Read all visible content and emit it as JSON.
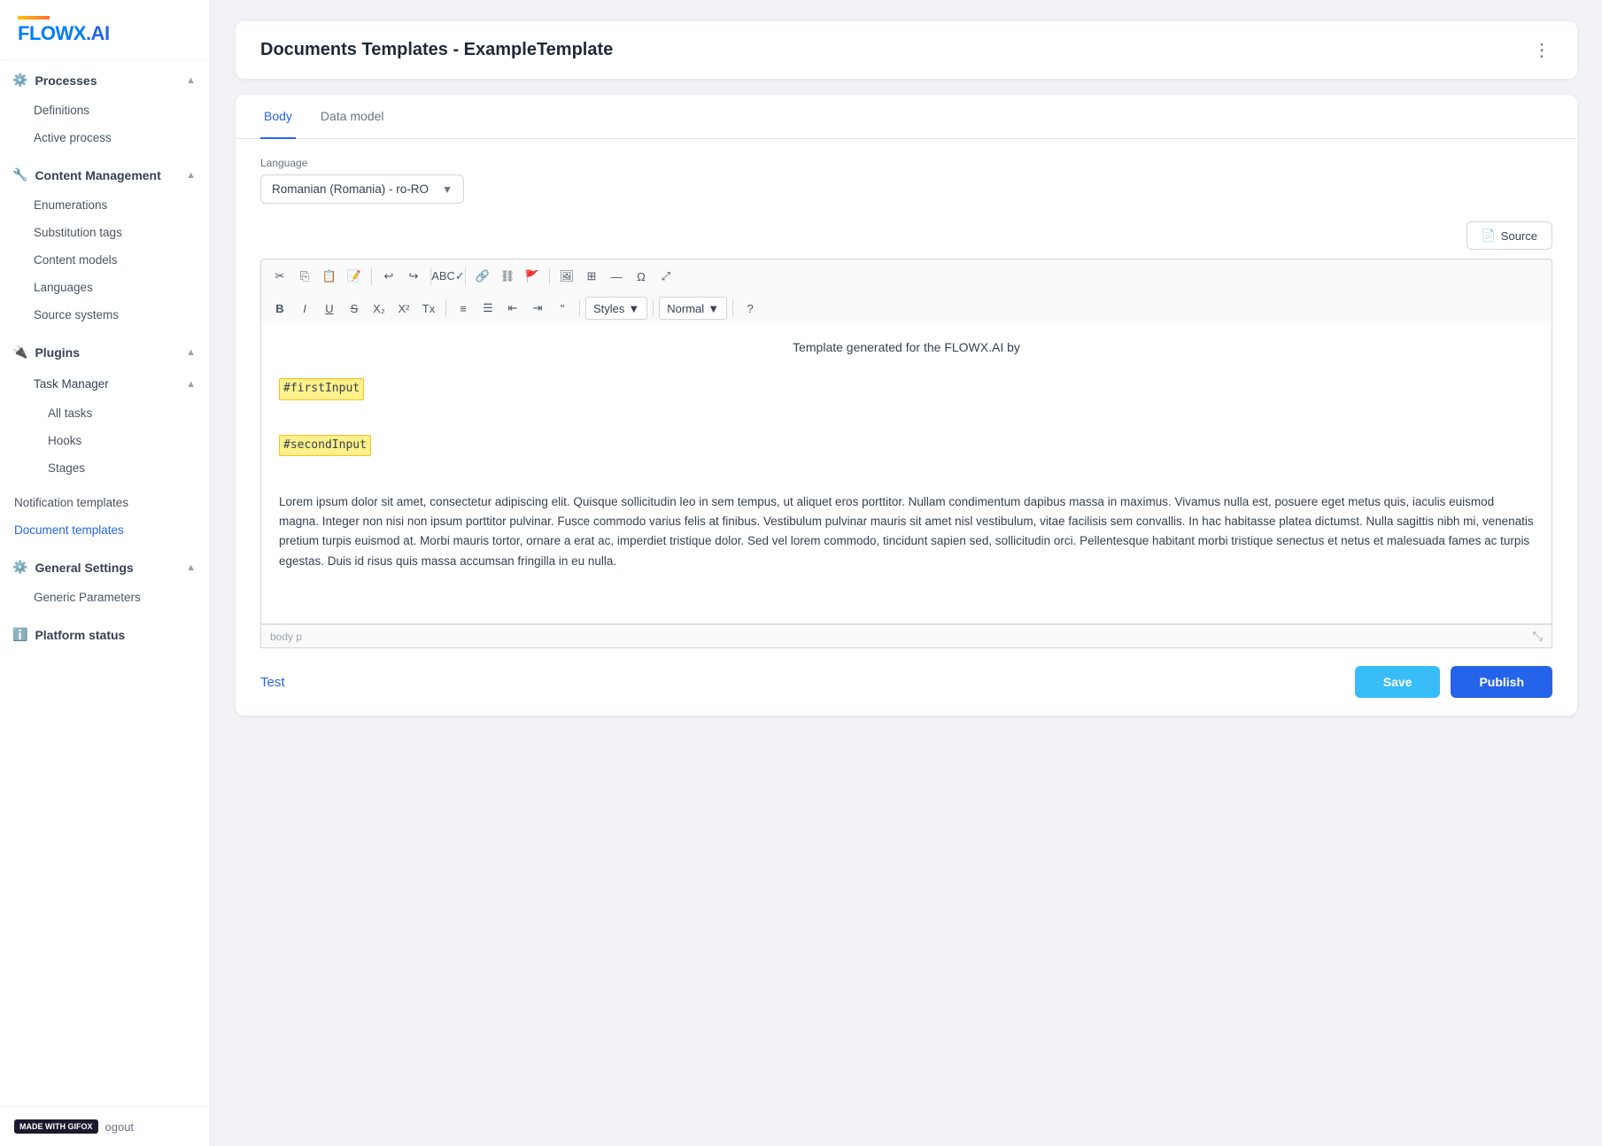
{
  "sidebar": {
    "logo": "FLOWX",
    "logo_dot": ".AI",
    "sections": [
      {
        "id": "processes",
        "label": "Processes",
        "icon": "⚙",
        "expanded": true,
        "items": [
          {
            "id": "definitions",
            "label": "Definitions",
            "active": false
          },
          {
            "id": "active-process",
            "label": "Active process",
            "active": false
          }
        ]
      },
      {
        "id": "content-management",
        "label": "Content Management",
        "icon": "🔧",
        "expanded": true,
        "items": [
          {
            "id": "enumerations",
            "label": "Enumerations",
            "active": false
          },
          {
            "id": "substitution-tags",
            "label": "Substitution tags",
            "active": false
          },
          {
            "id": "content-models",
            "label": "Content models",
            "active": false
          },
          {
            "id": "languages",
            "label": "Languages",
            "active": false
          },
          {
            "id": "source-systems",
            "label": "Source systems",
            "active": false
          }
        ]
      },
      {
        "id": "plugins",
        "label": "Plugins",
        "icon": "🔌",
        "expanded": true,
        "items": [],
        "children": [
          {
            "id": "task-manager",
            "label": "Task Manager",
            "expanded": true,
            "items": [
              {
                "id": "all-tasks",
                "label": "All tasks",
                "active": false
              },
              {
                "id": "hooks",
                "label": "Hooks",
                "active": false
              },
              {
                "id": "stages",
                "label": "Stages",
                "active": false
              }
            ]
          }
        ]
      },
      {
        "id": "notification-templates",
        "label": "Notification templates",
        "active": false
      },
      {
        "id": "document-templates",
        "label": "Document templates",
        "active": true
      },
      {
        "id": "general-settings",
        "label": "General Settings",
        "icon": "⚙",
        "expanded": true,
        "items": [
          {
            "id": "generic-parameters",
            "label": "Generic Parameters",
            "active": false
          }
        ]
      },
      {
        "id": "platform-status",
        "label": "Platform status",
        "icon": "ℹ",
        "expanded": false
      }
    ],
    "footer": {
      "badge": "MADE WITH GIFOX",
      "logout": "ogout"
    }
  },
  "page": {
    "title": "Documents Templates - ExampleTemplate",
    "tabs": [
      {
        "id": "body",
        "label": "Body",
        "active": true
      },
      {
        "id": "data-model",
        "label": "Data model",
        "active": false
      }
    ],
    "language_label": "Language",
    "language_value": "Romanian (Romania) - ro-RO",
    "source_button": "Source",
    "toolbar": {
      "styles_label": "Styles",
      "normal_label": "Normal",
      "help_icon": "?"
    },
    "editor": {
      "center_text": "Template generated for the FLOWX.AI by",
      "tag1": "#firstInput",
      "tag2": "#secondInput",
      "body_text": "Lorem ipsum dolor sit amet, consectetur adipiscing elit. Quisque sollicitudin leo in sem tempus, ut aliquet eros porttitor. Nullam condimentum dapibus massa in maximus. Vivamus nulla est, posuere eget metus quis, iaculis euismod magna. Integer non nisi non ipsum porttitor pulvinar. Fusce commodo varius felis at finibus. Vestibulum pulvinar mauris sit amet nisl vestibulum, vitae facilisis sem convallis. In hac habitasse platea dictumst. Nulla sagittis nibh mi, venenatis pretium turpis euismod at. Morbi mauris tortor, ornare a erat ac, imperdiet tristique dolor. Sed vel lorem commodo, tincidunt sapien sed, sollicitudin orci. Pellentesque habitant morbi tristique senectus et netus et malesuada fames ac turpis egestas. Duis id risus quis massa accumsan fringilla in eu nulla.",
      "statusbar": "body  p"
    },
    "actions": {
      "test_label": "Test",
      "save_label": "Save",
      "publish_label": "Publish"
    }
  }
}
